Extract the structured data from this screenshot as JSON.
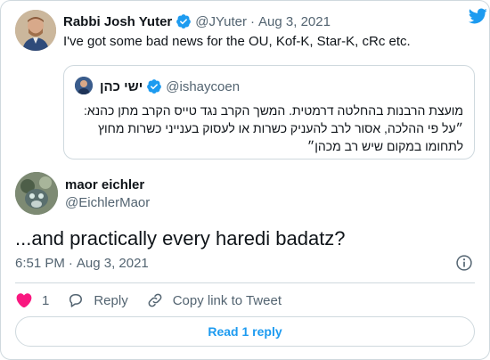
{
  "parent_tweet": {
    "display_name": "Rabbi Josh Yuter",
    "handle": "@JYuter",
    "separator": "·",
    "date": "Aug 3, 2021",
    "text": "I've got some bad news for the OU, Kof-K, Star-K, cRc etc."
  },
  "quoted_tweet": {
    "display_name": "ישי כהן",
    "handle": "@ishaycoen",
    "text": "מועצת הרבנות בהחלטה דרמטית. המשך הקרב נגד טייס הקרב מתן כהנא: ״על פי ההלכה, אסור לרב להעניק כשרות או לעסוק בענייני כשרות מחוץ לתחומו במקום שיש רב מכהן״"
  },
  "main_tweet": {
    "display_name": "maor eichler",
    "handle": "@EichlerMaor",
    "text": "...and practically every haredi badatz?",
    "time": "6:51 PM",
    "separator": "·",
    "date": "Aug 3, 2021"
  },
  "actions": {
    "like_count": "1",
    "reply_label": "Reply",
    "copy_link_label": "Copy link to Tweet"
  },
  "read_reply_label": "Read 1 reply",
  "icons": {
    "brand": "twitter-bird-icon",
    "verified": "verified-badge-icon",
    "info": "info-icon",
    "like": "heart-icon",
    "reply": "reply-bubble-icon",
    "link": "link-icon"
  },
  "colors": {
    "accent": "#1d9bf0",
    "like": "#f91880",
    "text_secondary": "#536471",
    "border": "#cfd9de"
  }
}
